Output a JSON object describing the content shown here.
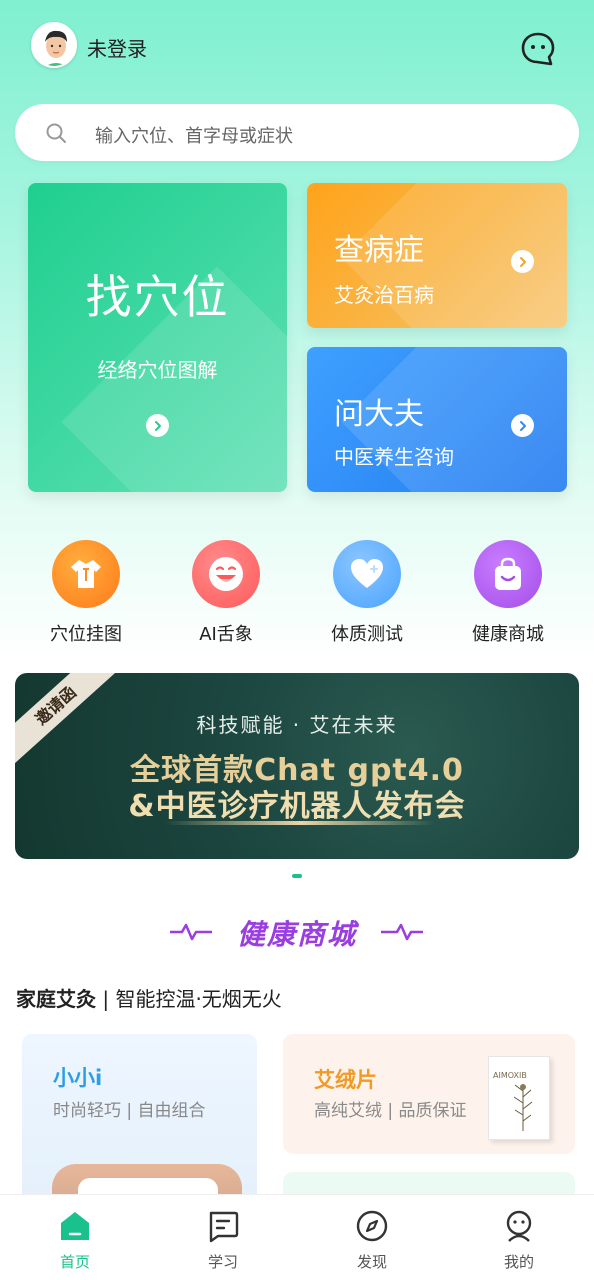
{
  "header": {
    "login_text": "未登录"
  },
  "search": {
    "placeholder": "输入穴位、首字母或症状"
  },
  "cards": {
    "find": {
      "title": "找穴位",
      "subtitle": "经络穴位图解"
    },
    "disease": {
      "title": "查病症",
      "subtitle": "艾灸治百病"
    },
    "doctor": {
      "title": "问大夫",
      "subtitle": "中医养生咨询"
    }
  },
  "quick_links": [
    {
      "label": "穴位挂图",
      "icon": "shirt-icon",
      "color": "#ff7a1a"
    },
    {
      "label": "AI舌象",
      "icon": "smile-tongue-icon",
      "color": "#ff5a5a"
    },
    {
      "label": "体质测试",
      "icon": "heart-plus-icon",
      "color": "#4aa3ff"
    },
    {
      "label": "健康商城",
      "icon": "shopping-bag-icon",
      "color": "#a44ee8"
    }
  ],
  "banner": {
    "ribbon": "邀请函",
    "line1": "科技赋能 · 艾在未来",
    "line2": "全球首款Chat gpt4.0",
    "line3": "&中医诊疗机器人发布会"
  },
  "section": {
    "title": "健康商城"
  },
  "family": {
    "bold": "家庭艾灸",
    "rest": " | 智能控温·无烟无火"
  },
  "products": [
    {
      "title": "小小i",
      "subtitle": "时尚轻巧 | 自由组合"
    },
    {
      "title": "艾绒片",
      "subtitle": "高纯艾绒 | 品质保证",
      "box_text": "AIMOXIB"
    }
  ],
  "tabs": [
    {
      "label": "首页",
      "icon": "home-icon",
      "active": true
    },
    {
      "label": "学习",
      "icon": "learn-icon",
      "active": false
    },
    {
      "label": "发现",
      "icon": "compass-icon",
      "active": false
    },
    {
      "label": "我的",
      "icon": "profile-icon",
      "active": false
    }
  ],
  "colors": {
    "accent": "#19c28d",
    "purple": "#9a3ee0"
  }
}
